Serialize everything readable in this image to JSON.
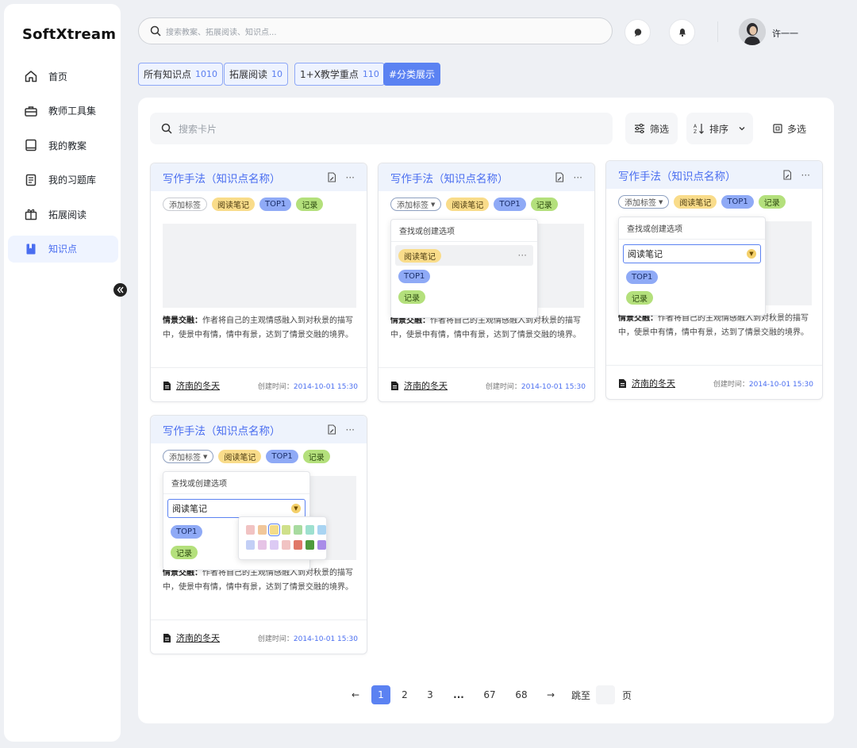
{
  "app": {
    "logo": "SoftXtream"
  },
  "sidebar": {
    "items": [
      {
        "label": "首页",
        "icon": "home-icon"
      },
      {
        "label": "教师工具集",
        "icon": "toolbox-icon"
      },
      {
        "label": "我的教案",
        "icon": "book-icon"
      },
      {
        "label": "我的习题库",
        "icon": "document-list-icon"
      },
      {
        "label": "拓展阅读",
        "icon": "package-icon"
      },
      {
        "label": "知识点",
        "icon": "bookmark-icon"
      }
    ],
    "active_index": 5
  },
  "header": {
    "search_placeholder": "搜索教案、拓展阅读、知识点...",
    "user_name": "许一一"
  },
  "filters": [
    {
      "label": "所有知识点",
      "count": "1010"
    },
    {
      "label": "拓展阅读",
      "count": "10"
    },
    {
      "label": "1+X教学重点",
      "count": "110"
    },
    {
      "label": "#分类展示",
      "count": ""
    }
  ],
  "toolbar": {
    "search_placeholder": "搜索卡片",
    "filter_label": "筛选",
    "sort_label": "排序",
    "multi_label": "多选"
  },
  "card": {
    "title": "写作手法（知识点名称）",
    "add_tag": "添加标签",
    "tags": [
      "阅读笔记",
      "TOP1",
      "记录"
    ],
    "desc_label": "情景交融：",
    "desc_text": "作者将自己的主观情感融入到对秋景的描写中，使景中有情，情中有景，达到了情景交融的境界。",
    "source": "济南的冬天",
    "created_label": "创建时间：",
    "created_time": "2014-10-01 15:30"
  },
  "dropdown": {
    "header": "查找或创建选项",
    "input_value": "阅读笔记",
    "options": [
      "阅读笔记",
      "TOP1",
      "记录"
    ]
  },
  "palette": {
    "row1": [
      "#f1c3c3",
      "#f1c79a",
      "#f4dc88",
      "#cfe08a",
      "#a8dba0",
      "#9ee0cf",
      "#a9d4f2"
    ],
    "row2": [
      "#c3cff6",
      "#e6c4e6",
      "#dccaf4",
      "#f1c3c3",
      "#e07868",
      "#4f9a3e",
      "#a98ce8"
    ],
    "selected": "#f4dc88"
  },
  "pagination": {
    "prev": "←",
    "pages": [
      "1",
      "2",
      "3",
      "...",
      "67",
      "68"
    ],
    "current": "1",
    "next": "→",
    "jump_label": "跳至",
    "page_label": "页"
  }
}
